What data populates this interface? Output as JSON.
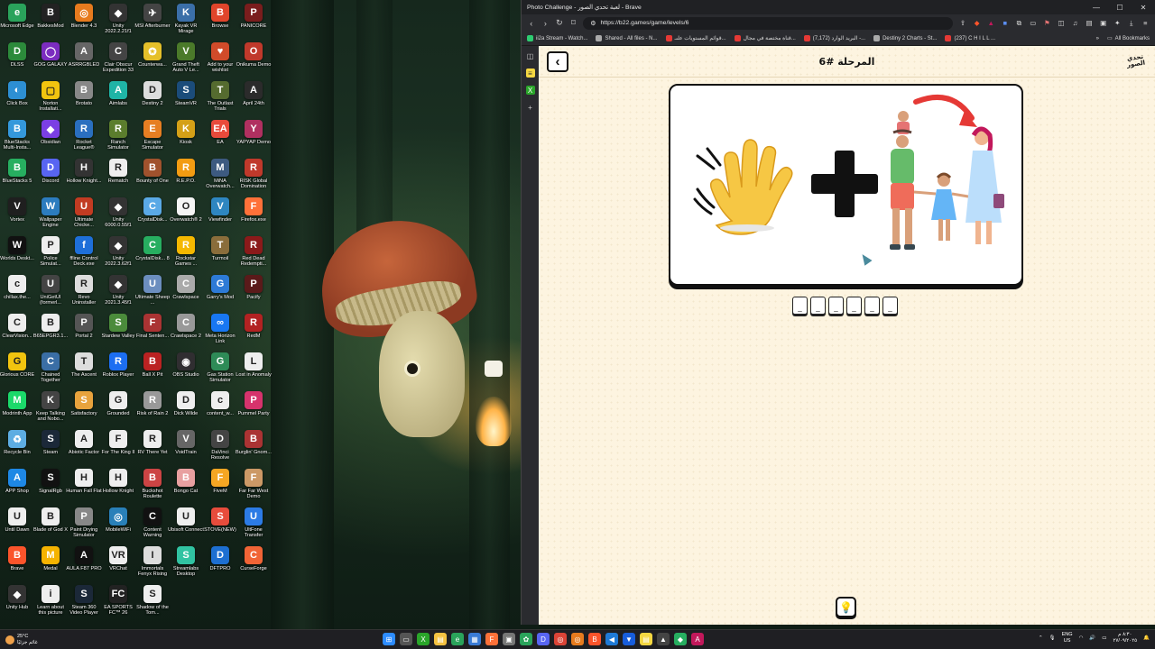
{
  "desktop": {
    "icons": [
      {
        "label": "Microsoft Edge",
        "color": "#2aa35b",
        "glyph": "e"
      },
      {
        "label": "BakkesMod",
        "color": "#222",
        "glyph": "B"
      },
      {
        "label": "Blender 4.3",
        "color": "#e77b1e",
        "glyph": "◎"
      },
      {
        "label": "Unity 2022.2.21f1",
        "color": "#333",
        "glyph": "◆"
      },
      {
        "label": "MSI Afterburner",
        "color": "#444",
        "glyph": "✈"
      },
      {
        "label": "Kayak VR Mirage",
        "color": "#3b6fa8",
        "glyph": "K"
      },
      {
        "label": "Browse",
        "color": "#e0452b",
        "glyph": "B"
      },
      {
        "label": "PANICORE",
        "color": "#7a1d1d",
        "glyph": "P"
      },
      {
        "label": "DLSS",
        "color": "#2c8a3b",
        "glyph": "D"
      },
      {
        "label": "GOG GALAXY",
        "color": "#7b2cbf",
        "glyph": "◯"
      },
      {
        "label": "ASRRGBLED",
        "color": "#666",
        "glyph": "A"
      },
      {
        "label": "Clair Obscur Expedition 33",
        "color": "#444",
        "glyph": "C"
      },
      {
        "label": "Counterwa...",
        "color": "#e5c02a",
        "glyph": "✪"
      },
      {
        "label": "Grand Theft Auto V Le...",
        "color": "#4b7a2a",
        "glyph": "V"
      },
      {
        "label": "Add to your wishlist",
        "color": "#d14b2a",
        "glyph": "♥"
      },
      {
        "label": "Onikuma Demo",
        "color": "#c0392b",
        "glyph": "O"
      },
      {
        "label": "Click Box",
        "color": "#2d8fd3",
        "glyph": "◐"
      },
      {
        "label": "Norton Installati...",
        "color": "#f1c40f",
        "glyph": "▢"
      },
      {
        "label": "Brotato",
        "color": "#888",
        "glyph": "B"
      },
      {
        "label": "Aimlabs",
        "color": "#1fb4a6",
        "glyph": "A"
      },
      {
        "label": "Destiny 2",
        "color": "#ddd",
        "glyph": "D"
      },
      {
        "label": "SteamVR",
        "color": "#1b4c7a",
        "glyph": "S"
      },
      {
        "label": "The Outlast Trials",
        "color": "#556b2f",
        "glyph": "T"
      },
      {
        "label": "April 24th",
        "color": "#2b2b2b",
        "glyph": "A"
      },
      {
        "label": "BlueStacks Multi-Insta...",
        "color": "#3498db",
        "glyph": "B"
      },
      {
        "label": "Obsidian",
        "color": "#7b3fe4",
        "glyph": "◆"
      },
      {
        "label": "Rocket League®",
        "color": "#2a6fbf",
        "glyph": "R"
      },
      {
        "label": "Ranch Simulator",
        "color": "#5b7d2d",
        "glyph": "R"
      },
      {
        "label": "Escape Simulator",
        "color": "#e67e22",
        "glyph": "E"
      },
      {
        "label": "Kiosk",
        "color": "#d4a017",
        "glyph": "K"
      },
      {
        "label": "EA",
        "color": "#e84a3b",
        "glyph": "EA"
      },
      {
        "label": "YAPYAP Demo",
        "color": "#b03060",
        "glyph": "Y"
      },
      {
        "label": "BlueStacks 5",
        "color": "#27ae60",
        "glyph": "B"
      },
      {
        "label": "Discord",
        "color": "#5865f2",
        "glyph": "D"
      },
      {
        "label": "Hollow Knight...",
        "color": "#333",
        "glyph": "H"
      },
      {
        "label": "Rematch",
        "color": "#eee",
        "glyph": "R"
      },
      {
        "label": "Bounty of One",
        "color": "#a0522d",
        "glyph": "B"
      },
      {
        "label": "R.E.P.O.",
        "color": "#f39c12",
        "glyph": "R"
      },
      {
        "label": "MiNA Overwatch...",
        "color": "#3d5a80",
        "glyph": "M"
      },
      {
        "label": "RISK Global Domination",
        "color": "#c0392b",
        "glyph": "R"
      },
      {
        "label": "Vortex",
        "color": "#1f1f1f",
        "glyph": "V"
      },
      {
        "label": "Wallpaper Engine",
        "color": "#2c7cbf",
        "glyph": "W"
      },
      {
        "label": "Ultimate Chicke...",
        "color": "#c23b22",
        "glyph": "U"
      },
      {
        "label": "Unity 6000.0.55f1",
        "color": "#333",
        "glyph": "◆"
      },
      {
        "label": "CrystalDisk...",
        "color": "#5aa9e6",
        "glyph": "C"
      },
      {
        "label": "Overwatch® 2",
        "color": "#f5f5f5",
        "glyph": "O"
      },
      {
        "label": "Viewfinder",
        "color": "#2e86c1",
        "glyph": "V"
      },
      {
        "label": "Firefox.exe",
        "color": "#ff7139",
        "glyph": "F"
      },
      {
        "label": "Worlds Deskt...",
        "color": "#111",
        "glyph": "W"
      },
      {
        "label": "Police Simulat...",
        "color": "#eee",
        "glyph": "P"
      },
      {
        "label": "ffline Control Deck.exe",
        "color": "#1e6fd9",
        "glyph": "f"
      },
      {
        "label": "Unity 2022.3.62f1",
        "color": "#333",
        "glyph": "◆"
      },
      {
        "label": "CrystalDisk... 8",
        "color": "#27ae60",
        "glyph": "C"
      },
      {
        "label": "Rockstar Games ...",
        "color": "#f5b800",
        "glyph": "R"
      },
      {
        "label": "Turmoil",
        "color": "#8a6d3b",
        "glyph": "T"
      },
      {
        "label": "Red Dead Redempti...",
        "color": "#8b1a1a",
        "glyph": "R"
      },
      {
        "label": "chillax.the...",
        "color": "#eee",
        "glyph": "c"
      },
      {
        "label": "UniGetUI (formerl...",
        "color": "#444",
        "glyph": "U"
      },
      {
        "label": "Revo Uninstaller",
        "color": "#ddd",
        "glyph": "R"
      },
      {
        "label": "Unity 2021.3.45f1",
        "color": "#333",
        "glyph": "◆"
      },
      {
        "label": "Ultimate Sheep ...",
        "color": "#6c8ebf",
        "glyph": "U"
      },
      {
        "label": "Crawlspace",
        "color": "#aaa",
        "glyph": "C"
      },
      {
        "label": "Garry's Mod",
        "color": "#2d7ad6",
        "glyph": "G"
      },
      {
        "label": "Pacify",
        "color": "#5a1a1a",
        "glyph": "P"
      },
      {
        "label": "ClearVision...",
        "color": "#eee",
        "glyph": "C"
      },
      {
        "label": "B65EPGR3.1...",
        "color": "#eee",
        "glyph": "B"
      },
      {
        "label": "Portal 2",
        "color": "#555",
        "glyph": "P"
      },
      {
        "label": "Stardew Valley",
        "color": "#4b8b3b",
        "glyph": "S"
      },
      {
        "label": "Final Senten...",
        "color": "#a33",
        "glyph": "F"
      },
      {
        "label": "Crawlspace 2",
        "color": "#999",
        "glyph": "C"
      },
      {
        "label": "Meta Horizon Link",
        "color": "#1877f2",
        "glyph": "∞"
      },
      {
        "label": "RedM",
        "color": "#b22222",
        "glyph": "R"
      },
      {
        "label": "Glorious CORE",
        "color": "#f1c40f",
        "glyph": "G"
      },
      {
        "label": "Chained Together",
        "color": "#3a6ea5",
        "glyph": "C"
      },
      {
        "label": "The Ascent",
        "color": "#ddd",
        "glyph": "T"
      },
      {
        "label": "Roblox Player",
        "color": "#1c6ef2",
        "glyph": "R"
      },
      {
        "label": "Ball X Pit",
        "color": "#b22",
        "glyph": "B"
      },
      {
        "label": "OBS Studio",
        "color": "#302e31",
        "glyph": "◉"
      },
      {
        "label": "Gas Station Simulator",
        "color": "#2e8b57",
        "glyph": "G"
      },
      {
        "label": "Lost in Anomaly",
        "color": "#eee",
        "glyph": "L"
      },
      {
        "label": "Modrinth App",
        "color": "#1bd96a",
        "glyph": "M"
      },
      {
        "label": "Keep Talking and Nobo...",
        "color": "#444",
        "glyph": "K"
      },
      {
        "label": "Satisfactory",
        "color": "#e8a33d",
        "glyph": "S"
      },
      {
        "label": "Grounded",
        "color": "#eee",
        "glyph": "G"
      },
      {
        "label": "Risk of Rain 2",
        "color": "#999",
        "glyph": "R"
      },
      {
        "label": "Dick Wilde",
        "color": "#eee",
        "glyph": "D"
      },
      {
        "label": "content_w...",
        "color": "#eee",
        "glyph": "c"
      },
      {
        "label": "Pummel Party",
        "color": "#d6336c",
        "glyph": "P"
      },
      {
        "label": "Recycle Bin",
        "color": "#5dade2",
        "glyph": "♻"
      },
      {
        "label": "Steam",
        "color": "#1b2838",
        "glyph": "S"
      },
      {
        "label": "Abiotic Factor",
        "color": "#eee",
        "glyph": "A"
      },
      {
        "label": "For The King II",
        "color": "#eee",
        "glyph": "F"
      },
      {
        "label": "RV There Yet",
        "color": "#eee",
        "glyph": "R"
      },
      {
        "label": "VoidTrain",
        "color": "#666",
        "glyph": "V"
      },
      {
        "label": "DaVinci Resolve",
        "color": "#444",
        "glyph": "D"
      },
      {
        "label": "Burglin' Gnom...",
        "color": "#a33",
        "glyph": "B"
      },
      {
        "label": "APP Shop",
        "color": "#1e88e5",
        "glyph": "A"
      },
      {
        "label": "SignalRgb",
        "color": "#111",
        "glyph": "S"
      },
      {
        "label": "Human Fall Flat",
        "color": "#eee",
        "glyph": "H"
      },
      {
        "label": "Hollow Knight",
        "color": "#eee",
        "glyph": "H"
      },
      {
        "label": "Buckshot Roulette",
        "color": "#c44",
        "glyph": "B"
      },
      {
        "label": "Bongo Cat",
        "color": "#e8a0a0",
        "glyph": "B"
      },
      {
        "label": "FiveM",
        "color": "#f5a623",
        "glyph": "F"
      },
      {
        "label": "Far Far West Demo",
        "color": "#c96",
        "glyph": "F"
      },
      {
        "label": "Until Dawn",
        "color": "#eee",
        "glyph": "U"
      },
      {
        "label": "Blade of God X",
        "color": "#eee",
        "glyph": "B"
      },
      {
        "label": "Paint Drying Simulator",
        "color": "#888",
        "glyph": "P"
      },
      {
        "label": "MobileWiFi",
        "color": "#2980b9",
        "glyph": "◎"
      },
      {
        "label": "Content Warning",
        "color": "#111",
        "glyph": "C"
      },
      {
        "label": "Ubisoft Connect",
        "color": "#eee",
        "glyph": "U"
      },
      {
        "label": "STOVE(NEW)",
        "color": "#e74c3c",
        "glyph": "S"
      },
      {
        "label": "UltFone Transfer",
        "color": "#2c7be5",
        "glyph": "U"
      },
      {
        "label": "Brave",
        "color": "#fb542b",
        "glyph": "B"
      },
      {
        "label": "Medal",
        "color": "#f5b301",
        "glyph": "M"
      },
      {
        "label": "AULA F87 PRO",
        "color": "#111",
        "glyph": "A"
      },
      {
        "label": "VRChat",
        "color": "#eee",
        "glyph": "VR"
      },
      {
        "label": "Immortals Fenyx Rising",
        "color": "#ddd",
        "glyph": "I"
      },
      {
        "label": "Streamlabs Desktop",
        "color": "#31c3a2",
        "glyph": "S"
      },
      {
        "label": "DFTPRO",
        "color": "#1d6fd1",
        "glyph": "D"
      },
      {
        "label": "CurseForge",
        "color": "#f16436",
        "glyph": "C"
      },
      {
        "label": "Unity Hub",
        "color": "#333",
        "glyph": "◆"
      },
      {
        "label": "Learn about this picture",
        "color": "#eee",
        "glyph": "i"
      },
      {
        "label": "Steam 360 Video Player",
        "color": "#1b2838",
        "glyph": "S"
      },
      {
        "label": "EA SPORTS FC™ 26",
        "color": "#222",
        "glyph": "FC"
      },
      {
        "label": "Shadow of the Tom...",
        "color": "#eee",
        "glyph": "S"
      }
    ]
  },
  "browser": {
    "window_title": "Photo Challenge - لعبة تحدي الصور - Brave",
    "url": "https://b22.games/game/levels/6",
    "bookmarks": [
      {
        "label": "ii2a Stream - Watch...",
        "color": "#2ecc71"
      },
      {
        "label": "Shared - All files - N...",
        "color": "#aaa"
      },
      {
        "label": "قوائم المستويات علىـ...",
        "color": "#e53935"
      },
      {
        "label": "قناة مختصة في مجال...",
        "color": "#e53935"
      },
      {
        "label": "(7,172) البريد الوارد -...",
        "color": "#e53935"
      },
      {
        "label": "Destiny 2 Charts - St...",
        "color": "#aaa"
      },
      {
        "label": "(237) C H I L L ...",
        "color": "#e53935"
      }
    ],
    "all_bookmarks_label": "All Bookmarks"
  },
  "game": {
    "level_title": "المرحلة #6",
    "logo_text_top": "تحدي",
    "logo_text_bottom": "الصور",
    "back_label": "‹",
    "answer_slots": [
      "_",
      "_",
      "_",
      "_",
      "_",
      "_"
    ],
    "hint_icon": "lightbulb-icon",
    "puzzle_parts": [
      "waving-hand",
      "plus",
      "family-mother-highlighted"
    ],
    "accent_color": "#e53935"
  },
  "taskbar": {
    "weather_temp": "25°C",
    "weather_desc": "غائم جزئيًا",
    "language": "ENG",
    "region": "US",
    "time": "٨:٣٠ م",
    "date": "٢٧/٠٩/٢٠٢٥",
    "apps": [
      {
        "name": "start-icon",
        "color": "#2d8cff",
        "glyph": "⊞"
      },
      {
        "name": "task-view-icon",
        "color": "#555",
        "glyph": "▭"
      },
      {
        "name": "xbox-icon",
        "color": "#2aa52a",
        "glyph": "X"
      },
      {
        "name": "file-explorer-icon",
        "color": "#f5c242",
        "glyph": "▤"
      },
      {
        "name": "edge-icon",
        "color": "#2aa35b",
        "glyph": "e"
      },
      {
        "name": "store-icon",
        "color": "#3a7bd5",
        "glyph": "▦"
      },
      {
        "name": "firefox-icon",
        "color": "#ff7139",
        "glyph": "F"
      },
      {
        "name": "cube-icon",
        "color": "#777",
        "glyph": "▣"
      },
      {
        "name": "photos-icon",
        "color": "#2aa35b",
        "glyph": "✿"
      },
      {
        "name": "discord-icon",
        "color": "#5865f2",
        "glyph": "D"
      },
      {
        "name": "chrome-icon",
        "color": "#db4437",
        "glyph": "◎"
      },
      {
        "name": "blender-icon",
        "color": "#e77b1e",
        "glyph": "◎"
      },
      {
        "name": "brave-icon",
        "color": "#fb542b",
        "glyph": "B"
      },
      {
        "name": "vscode-icon",
        "color": "#1f7ad6",
        "glyph": "◀"
      },
      {
        "name": "bitwarden-icon",
        "color": "#175ddc",
        "glyph": "▼"
      },
      {
        "name": "sticky-notes-icon",
        "color": "#f5d742",
        "glyph": "▤"
      },
      {
        "name": "drive-icon",
        "color": "#444",
        "glyph": "▲"
      },
      {
        "name": "bluestacks-icon",
        "color": "#27ae60",
        "glyph": "◆"
      },
      {
        "name": "affinity-icon",
        "color": "#c2185b",
        "glyph": "A"
      }
    ]
  }
}
